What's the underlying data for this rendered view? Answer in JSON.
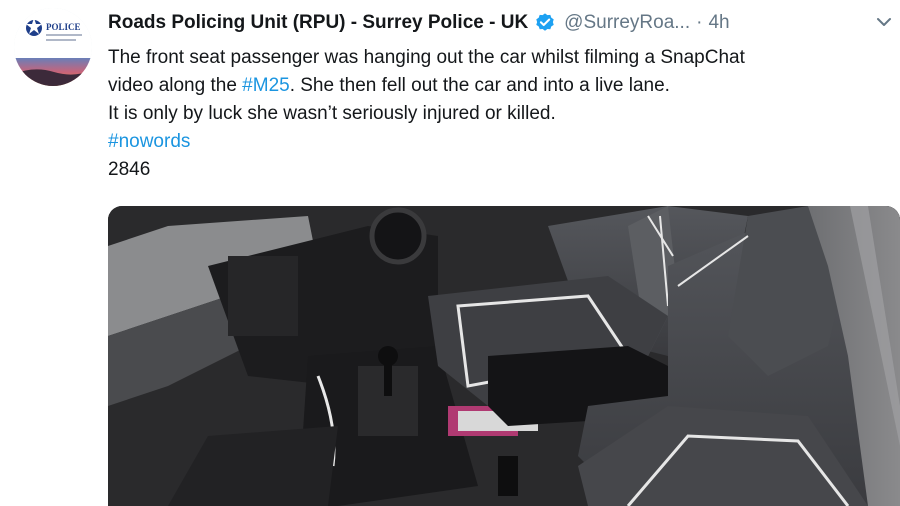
{
  "tweet": {
    "author_name": "Roads Policing Unit (RPU) - Surrey Police - UK",
    "handle": "@SurreyRoa...",
    "separator": "·",
    "timestamp": "4h",
    "text_lines": [
      {
        "before": "The front seat passenger was hanging out the car whilst filming a SnapChat",
        "hashtag": "",
        "after": ""
      },
      {
        "before": "video along the ",
        "hashtag": "#M25",
        "after": ". She then fell out the car and into a live lane."
      },
      {
        "before": "It is only by luck she wasn’t seriously injured or killed.",
        "hashtag": "",
        "after": ""
      }
    ],
    "hashtag_line": "#nowords",
    "reference_number": "2846",
    "media_description": "Car interior with empty front passenger seat and open door",
    "avatar_badge_text": "POLICE"
  },
  "icons": {
    "verified": "verified-badge-icon",
    "caret": "chevron-down-icon"
  },
  "colors": {
    "link": "#1b95e0",
    "text": "#14171a",
    "secondary": "#657786",
    "verified": "#1da1f2"
  }
}
